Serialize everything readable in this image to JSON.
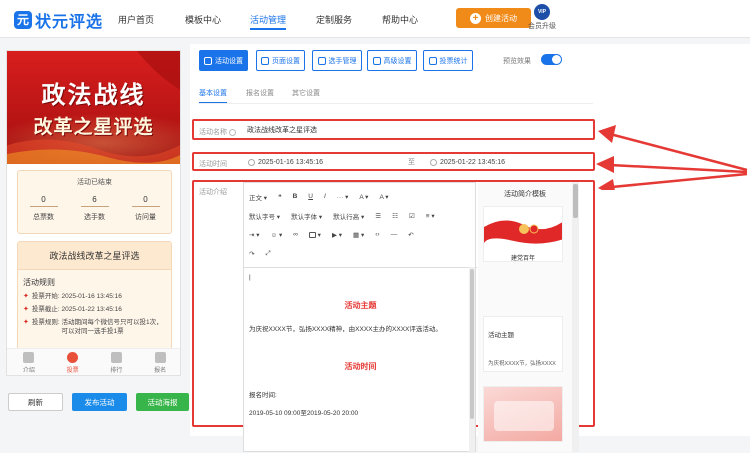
{
  "app": {
    "logo_text": "状元评选",
    "logo_mark": "元"
  },
  "nav": {
    "items": [
      "用户首页",
      "模板中心",
      "活动管理",
      "定制服务",
      "帮助中心"
    ],
    "active_index": 2
  },
  "header": {
    "create_label": "创建活动",
    "vip_badge": "VIP",
    "vip_label": "会员升级"
  },
  "preview": {
    "banner_line1": "政法战线",
    "banner_line2": "改革之星评选",
    "status_title": "活动已结束",
    "stats": [
      {
        "value": "0",
        "label": "总票数"
      },
      {
        "value": "6",
        "label": "选手数"
      },
      {
        "value": "0",
        "label": "访问量"
      }
    ],
    "rule_box_title": "政法战线改革之星评选",
    "rule_heading": "活动规则",
    "rules": [
      {
        "key": "投票开始:",
        "value": "2025-01-16 13:45:16"
      },
      {
        "key": "投票截止:",
        "value": "2025-01-22 13:45:16"
      },
      {
        "key": "投票规则:",
        "value": "活动期间每个微信号只可以投1次，可以对同一选手投1票"
      }
    ],
    "tabbar": [
      "介绍",
      "投票",
      "排行",
      "报名"
    ],
    "tabbar_active": 1
  },
  "actions": {
    "refresh": "刷新",
    "publish": "发布活动",
    "poster": "活动海报"
  },
  "toolbar": {
    "buttons": [
      "活动设置",
      "页面设置",
      "选手管理",
      "高级设置",
      "投票统计"
    ],
    "active_index": 0,
    "preview_effect_label": "预览效果",
    "preview_effect_on": true
  },
  "subtabs": {
    "items": [
      "基本设置",
      "报名设置",
      "其它设置"
    ],
    "active_index": 0
  },
  "form": {
    "name_label": "活动名称",
    "name_value": "政法战线改革之星评选",
    "time_label": "活动时间",
    "start_time": "2025-01-16 13:45:16",
    "time_separator": "至",
    "end_time": "2025-01-22 13:45:16",
    "intro_label": "活动介绍"
  },
  "editor": {
    "row1": [
      "正文",
      "❝",
      "B",
      "U",
      "I",
      "···",
      "A",
      "A"
    ],
    "row2": [
      "默认字号",
      "默认字体",
      "默认行高"
    ],
    "body_title1": "活动主题",
    "body_text1": "为庆祝XXXX节，弘扬XXXX精神，由XXXX主办的XXXX评选活动。",
    "body_title2": "活动时间",
    "body_text2": "报名时间:",
    "body_text3": "2019-05-10 09:00至2019-05-20 20:00"
  },
  "templates": {
    "title": "活动简介模板",
    "card1_caption": "建党百年",
    "card2_caption": "活动主题",
    "card2_text": "为庆祝XXXX节，弘扬XXXX"
  },
  "colors": {
    "accent": "#1a73e8",
    "highlight": "#e53935",
    "banner": "#d81e1e",
    "create": "#f08a18",
    "publish": "#1a8be8",
    "poster": "#38b54a"
  }
}
